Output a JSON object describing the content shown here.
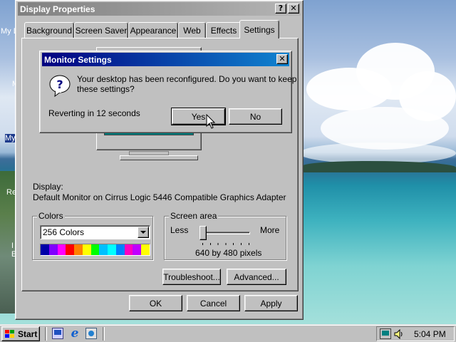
{
  "desktop": {
    "icon_labels": [
      "My D",
      "M",
      "My",
      "Re",
      "I",
      "E"
    ]
  },
  "display_properties": {
    "title": "Display Properties",
    "help_btn": "?",
    "close_btn": "✕",
    "tabs": [
      {
        "label": "Background"
      },
      {
        "label": "Screen Saver"
      },
      {
        "label": "Appearance"
      },
      {
        "label": "Web"
      },
      {
        "label": "Effects"
      },
      {
        "label": "Settings",
        "active": true
      }
    ],
    "display_label": "Display:",
    "display_value": "Default Monitor on Cirrus Logic 5446 Compatible Graphics Adapter",
    "colors": {
      "group_label": "Colors",
      "selected": "256 Colors",
      "palette": [
        "#0000a8",
        "#8000ff",
        "#ff00ff",
        "#ff0000",
        "#ff8000",
        "#ffff00",
        "#00ff00",
        "#00c0ff",
        "#00ffff",
        "#0080ff",
        "#ff00c0",
        "#c000ff",
        "#ffff00"
      ]
    },
    "screen_area": {
      "group_label": "Screen area",
      "less": "Less",
      "more": "More",
      "value_text": "640 by 480 pixels",
      "slider_position": 0.0
    },
    "troubleshoot": "Troubleshoot...",
    "advanced": "Advanced...",
    "ok": "OK",
    "cancel": "Cancel",
    "apply": "Apply"
  },
  "monitor_settings": {
    "title": "Monitor Settings",
    "close_btn": "✕",
    "question_icon": "?",
    "message_line1": "Your desktop has been reconfigured.  Do you want to keep",
    "message_line2": "these settings?",
    "countdown": "Reverting in 12 seconds",
    "yes": "Yes",
    "no": "No"
  },
  "taskbar": {
    "start": "Start",
    "clock": "5:04 PM"
  },
  "colors": {
    "title_active_start": "#000080",
    "title_active_end": "#1084d0",
    "title_inactive_start": "#808080",
    "title_inactive_end": "#b5b5b5",
    "face": "#c0c0c0"
  }
}
